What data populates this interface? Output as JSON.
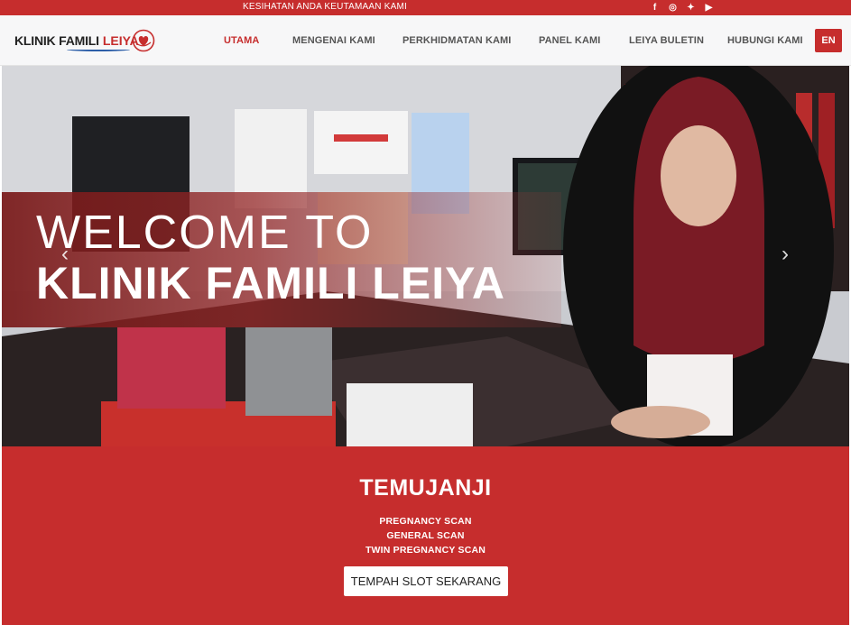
{
  "topbar": {
    "tagline": "KESIHATAN ANDA KEUTAMAAN KAMI",
    "socials": [
      {
        "icon": "facebook-icon",
        "glyph": "f"
      },
      {
        "icon": "instagram-icon",
        "glyph": "◎"
      },
      {
        "icon": "twitter-icon",
        "glyph": "✦"
      },
      {
        "icon": "youtube-icon",
        "glyph": "▶"
      }
    ]
  },
  "logo": {
    "part1": "KLINIK FAMILI",
    "part2": "LEIYA"
  },
  "nav": {
    "items": [
      "UTAMA",
      "MENGENAI KAMI",
      "PERKHIDMATAN KAMI",
      "PANEL KAMI",
      "LEIYA BULETIN",
      "HUBUNGI KAMI"
    ],
    "active": "UTAMA",
    "lang": "EN"
  },
  "hero": {
    "line1": "WELCOME TO",
    "line2": "KLINIK FAMILI LEIYA",
    "prev": "‹",
    "next": "›"
  },
  "appointment": {
    "title": "TEMUJANJI",
    "services": [
      "PREGNANCY SCAN",
      "GENERAL SCAN",
      "TWIN PREGNANCY SCAN"
    ],
    "button": "TEMPAH SLOT SEKARANG"
  },
  "colors": {
    "brand_red": "#c62d2d",
    "logo_blue": "#2c5ea8"
  }
}
